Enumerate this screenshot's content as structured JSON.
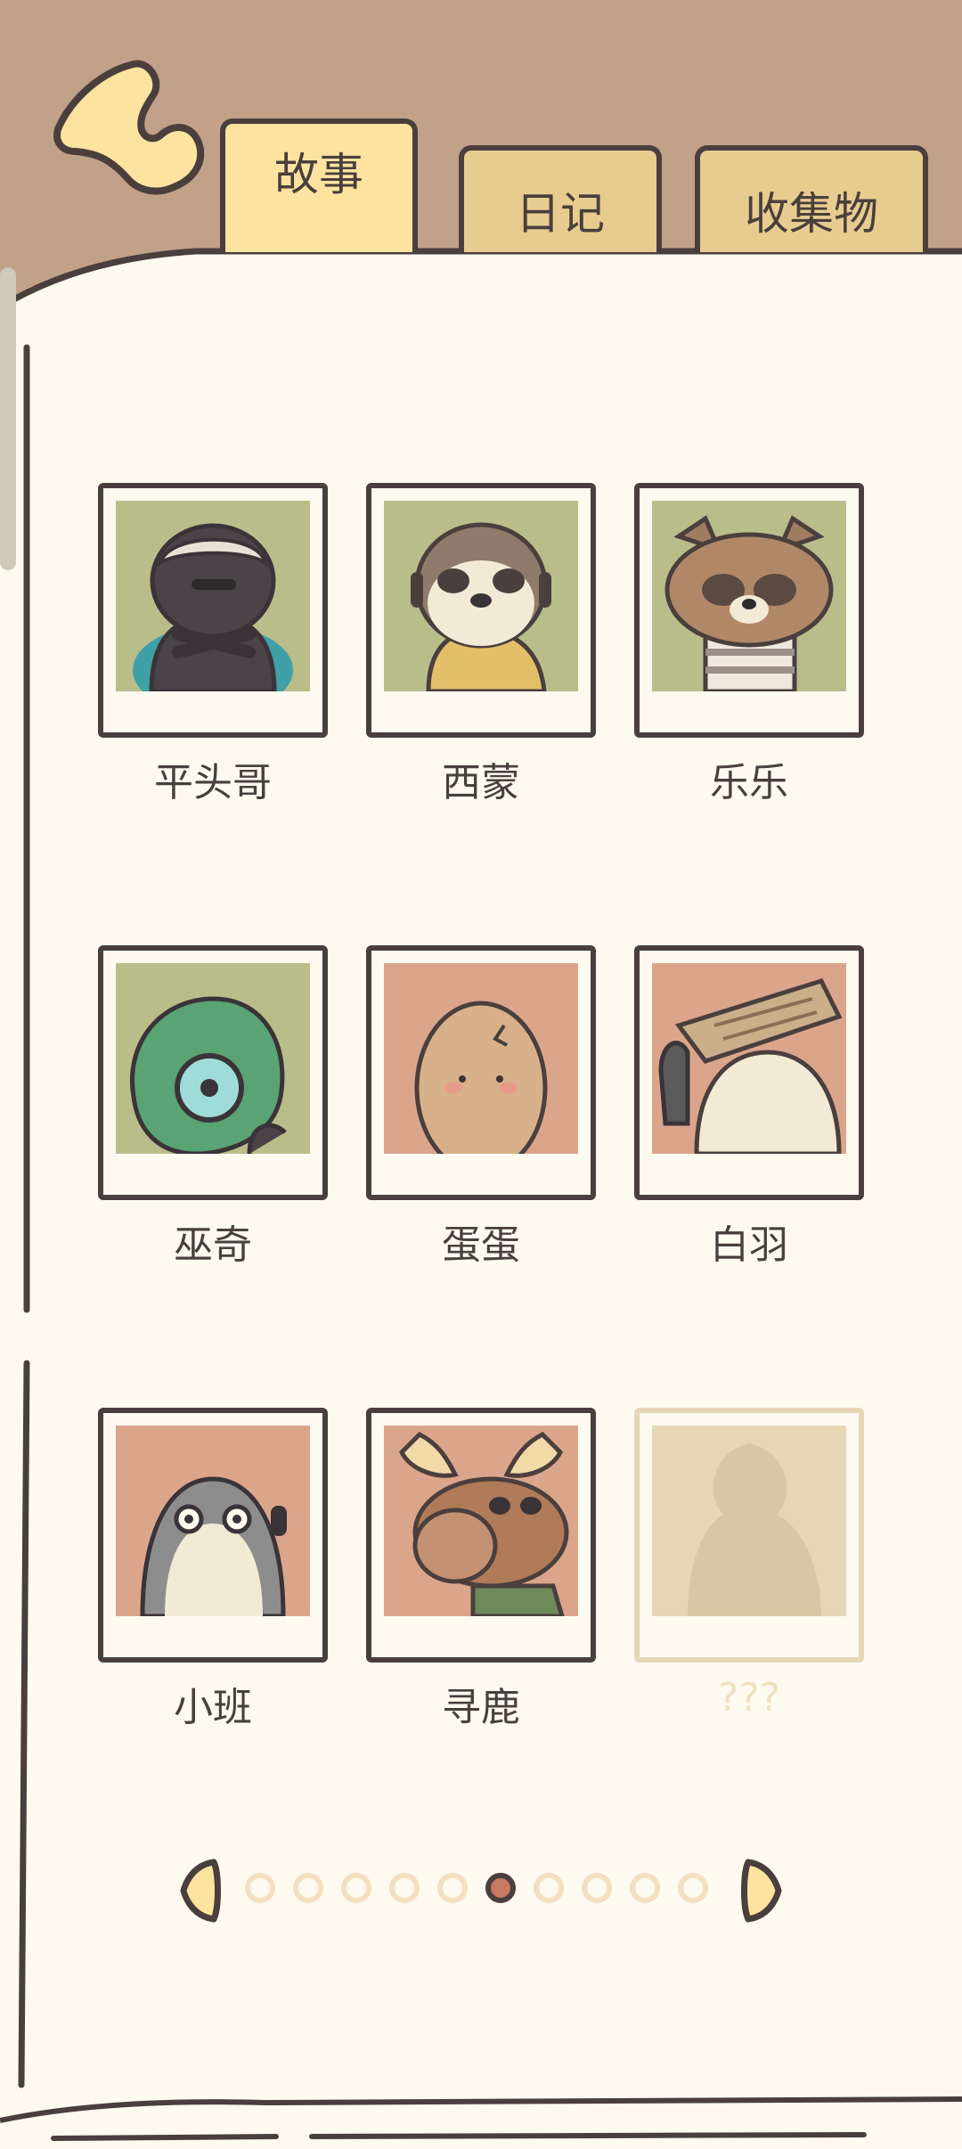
{
  "tabs": [
    {
      "id": "story",
      "label": "故事",
      "active": true
    },
    {
      "id": "diary",
      "label": "日记",
      "active": false
    },
    {
      "id": "collectibles",
      "label": "收集物",
      "active": false
    }
  ],
  "characters": [
    {
      "name": "平头哥",
      "locked": false,
      "bg": "#b9bd8a",
      "icon": "honey-badger-portrait"
    },
    {
      "name": "西蒙",
      "locked": false,
      "bg": "#b9bd8a",
      "icon": "meerkat-portrait"
    },
    {
      "name": "乐乐",
      "locked": false,
      "bg": "#b9bd8a",
      "icon": "raccoon-portrait"
    },
    {
      "name": "巫奇",
      "locked": false,
      "bg": "#b9bd8a",
      "icon": "chameleon-portrait"
    },
    {
      "name": "蛋蛋",
      "locked": false,
      "bg": "#dba58c",
      "icon": "egg-portrait"
    },
    {
      "name": "白羽",
      "locked": false,
      "bg": "#dba58c",
      "icon": "bird-with-hat-portrait"
    },
    {
      "name": "小班",
      "locked": false,
      "bg": "#dba58c",
      "icon": "otter-portrait"
    },
    {
      "name": "寻鹿",
      "locked": false,
      "bg": "#dba58c",
      "icon": "moose-portrait"
    },
    {
      "name": "???",
      "locked": true,
      "bg": "#e5d6b6",
      "icon": "silhouette-portrait"
    }
  ],
  "pagination": {
    "total": 10,
    "current": 6
  },
  "colors": {
    "background": "#c2a189",
    "paper": "#fffaf0",
    "ink": "#4a3f3d",
    "active_tab": "#fde3a0",
    "inactive_tab": "#e7cc8f",
    "active_dot": "#c97862",
    "inactive_dot": "#f1e1c0"
  }
}
